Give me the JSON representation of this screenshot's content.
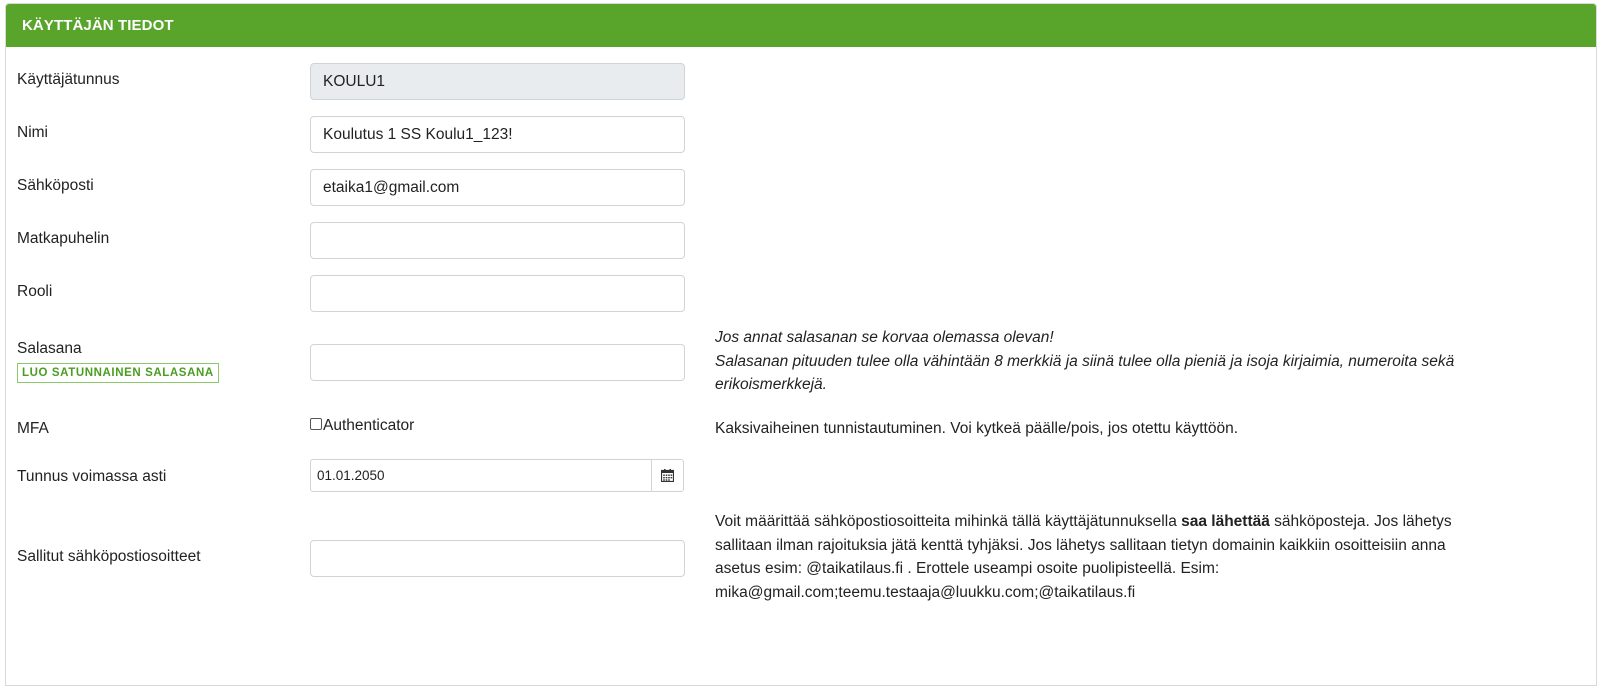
{
  "panel": {
    "title": "KÄYTTÄJÄN TIEDOT"
  },
  "fields": {
    "username": {
      "label": "Käyttäjätunnus",
      "value": "KOULU1"
    },
    "name": {
      "label": "Nimi",
      "value": "Koulutus 1 SS Koulu1_123!"
    },
    "email": {
      "label": "Sähköposti",
      "value": "etaika1@gmail.com"
    },
    "mobile": {
      "label": "Matkapuhelin",
      "value": ""
    },
    "role": {
      "label": "Rooli",
      "value": ""
    },
    "password": {
      "label": "Salasana",
      "value": "",
      "generate_label": "LUO SATUNNAINEN SALASANA",
      "help_1": "Jos annat salasanan se korvaa olemassa olevan!",
      "help_2": "Salasanan pituuden tulee olla vähintään 8 merkkiä ja siinä tulee olla pieniä ja isoja kirjaimia, numeroita sekä erikoismerkkejä."
    },
    "mfa": {
      "label": "MFA",
      "checkbox_label": "Authenticator",
      "checked": false,
      "help": "Kaksivaiheinen tunnistautuminen. Voi kytkeä päälle/pois, jos otettu käyttöön."
    },
    "valid_until": {
      "label": "Tunnus voimassa asti",
      "value": "01.01.2050",
      "icon": "calendar-icon"
    },
    "allowed_emails": {
      "label": "Sallitut sähköpostiosoitteet",
      "value": "",
      "help_before": "Voit määrittää sähköpostiosoitteita mihinkä tällä käyttäjätunnuksella ",
      "help_bold": "saa lähettää",
      "help_after": " sähköposteja. Jos lähetys sallitaan ilman rajoituksia jätä kenttä tyhjäksi. Jos lähetys sallitaan tietyn domainin kaikkiin osoitteisiin anna asetus esim: @taikatilaus.fi . Erottele useampi osoite puolipisteellä. Esim: mika@gmail.com;teemu.testaaja@luukku.com;@taikatilaus.fi"
    }
  },
  "colors": {
    "header_green": "#59a52c",
    "button_green": "#4a9d22",
    "readonly_bg": "#e9ecef"
  }
}
